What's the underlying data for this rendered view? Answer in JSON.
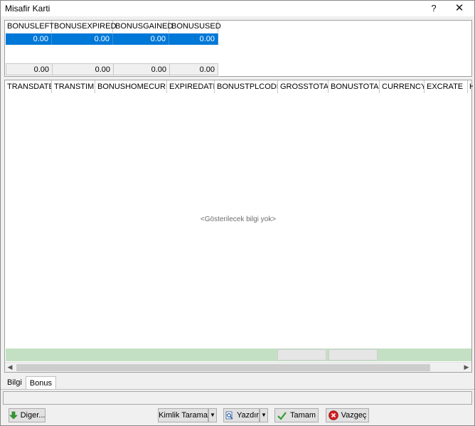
{
  "window": {
    "title": "Misafir Karti",
    "help_glyph": "?",
    "close_glyph": "✕"
  },
  "bonus_summary": {
    "columns": [
      "BONUSLEFT",
      "BONUSEXPIRED",
      "BONUSGAINED",
      "BONUSUSED"
    ],
    "row": [
      "0.00",
      "0.00",
      "0.00",
      "0.00"
    ],
    "totals": [
      "0.00",
      "0.00",
      "0.00",
      "0.00"
    ]
  },
  "transactions": {
    "columns": [
      "TRANSDATE",
      "TRANSTIME",
      "BONUSHOMECURR",
      "EXPIREDATE",
      "BONUSTPLCODE",
      "GROSSTOTAL",
      "BONUSTOTAL",
      "CURRENCY",
      "EXCRATE",
      "H"
    ],
    "empty_text": "<Gösterilecek bilgi yok>"
  },
  "tabs": [
    {
      "label": "Bilgi",
      "active": false
    },
    {
      "label": "Bonus",
      "active": true
    }
  ],
  "buttons": {
    "diger": "Diger...",
    "kimlik_tarama": "Kimlik Tarama",
    "yazdir": "Yazdır",
    "tamam": "Tamam",
    "vazgec": "Vazgeç"
  },
  "icons": {
    "diger": "green-down-arrow-icon",
    "yazdir": "print-preview-icon",
    "tamam": "green-check-icon",
    "vazgec": "red-cancel-icon"
  },
  "colors": {
    "selection": "#0078d7",
    "footer_green": "#c4e0c4"
  }
}
